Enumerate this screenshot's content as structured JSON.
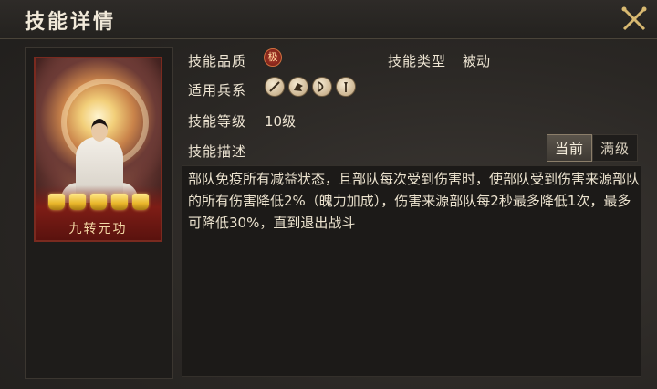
{
  "header": {
    "title": "技能详情"
  },
  "card": {
    "skill_name": "九转元功",
    "star_count": 5
  },
  "details": {
    "quality_label": "技能品质",
    "quality_badge": "极",
    "type_label": "技能类型",
    "type_value": "被动",
    "units_label": "适用兵系",
    "units": [
      "spear-icon",
      "cavalry-icon",
      "bow-icon",
      "halberd-icon"
    ],
    "level_label": "技能等级",
    "level_value": "10级",
    "desc_label": "技能描述"
  },
  "tabs": {
    "current": "当前",
    "max": "满级"
  },
  "description": "部队免疫所有减益状态，且部队每次受到伤害时，使部队受到伤害来源部队的所有伤害降低2%（魄力加成），伤害来源部队每2秒最多降低1次，最多可降低30%，直到退出战斗"
}
